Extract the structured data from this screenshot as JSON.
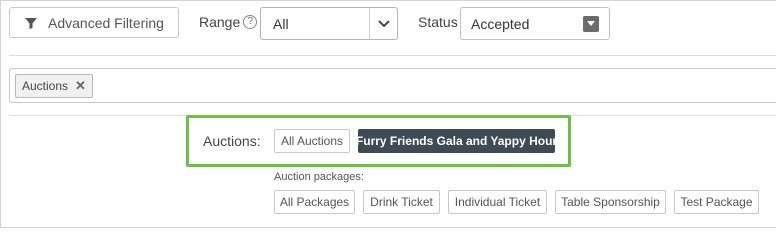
{
  "toolbar": {
    "advanced_filtering_label": "Advanced Filtering",
    "range_label": "Range",
    "range_value": "All",
    "status_label": "Status",
    "status_value": "Accepted"
  },
  "tags": [
    {
      "label": "Auctions",
      "remove": "✕"
    }
  ],
  "auctions": {
    "label": "Auctions:",
    "options": [
      "All Auctions",
      "Furry Friends Gala and Yappy Hour"
    ],
    "selected": "Furry Friends Gala and Yappy Hour"
  },
  "packages": {
    "label": "Auction packages:",
    "options": [
      "All Packages",
      "Drink Ticket",
      "Individual Ticket",
      "Table Sponsorship",
      "Test Package"
    ]
  },
  "colors": {
    "highlight_border": "#6fbf4a",
    "active_chip": "#3f4a56"
  }
}
